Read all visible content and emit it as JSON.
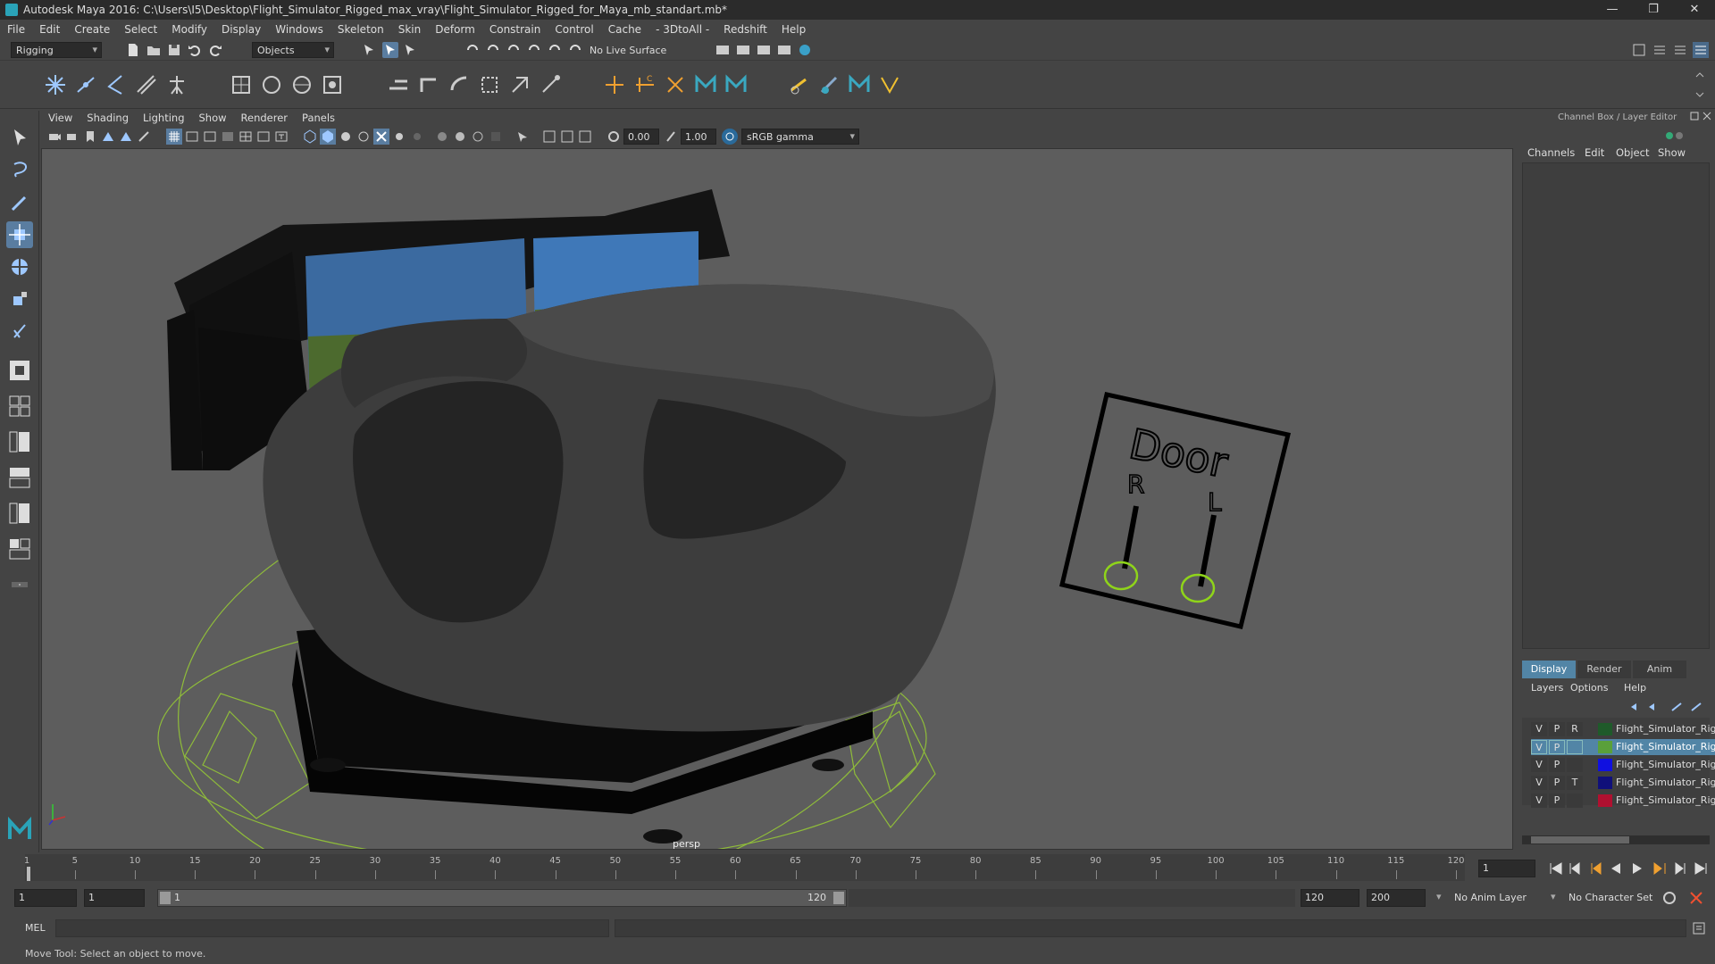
{
  "window": {
    "title": "Autodesk Maya 2016: C:\\Users\\I5\\Desktop\\Flight_Simulator_Rigged_max_vray\\Flight_Simulator_Rigged_for_Maya_mb_standart.mb*",
    "minimize": "—",
    "restore": "❐",
    "close": "✕"
  },
  "menubar": [
    "File",
    "Edit",
    "Create",
    "Select",
    "Modify",
    "Display",
    "Windows",
    "Skeleton",
    "Skin",
    "Deform",
    "Constrain",
    "Control",
    "Cache",
    "- 3DtoAll -",
    "Redshift",
    "Help"
  ],
  "statusline": {
    "menuset": "Rigging",
    "selection_mode": "Objects",
    "live_surface": "No Live Surface"
  },
  "panel": {
    "menus": [
      "View",
      "Shading",
      "Lighting",
      "Show",
      "Renderer",
      "Panels"
    ],
    "exposure": "0.00",
    "gamma": "1.00",
    "colorspace": "sRGB gamma",
    "camera_label": "persp"
  },
  "scene": {
    "door_label": "Door",
    "door_r": "R",
    "door_l": "L"
  },
  "channelbox": {
    "title": "Channel Box / Layer Editor",
    "menus": [
      "Channels",
      "Edit",
      "Object",
      "Show"
    ],
    "tabs": [
      "Display",
      "Render",
      "Anim"
    ],
    "layer_menus": [
      "Layers",
      "Options",
      "Help"
    ],
    "layers": [
      {
        "v": "V",
        "p": "P",
        "t": "R",
        "color": "#1f5a2a",
        "name": "Flight_Simulator_Rigg",
        "selected": false
      },
      {
        "v": "V",
        "p": "P",
        "t": "",
        "color": "#5aa03a",
        "name": "Flight_Simulator_Rigg",
        "selected": true
      },
      {
        "v": "V",
        "p": "P",
        "t": "",
        "color": "#1010e0",
        "name": "Flight_Simulator_Rigg",
        "selected": false
      },
      {
        "v": "V",
        "p": "P",
        "t": "T",
        "color": "#10107a",
        "name": "Flight_Simulator_Rigg",
        "selected": false
      },
      {
        "v": "V",
        "p": "P",
        "t": "",
        "color": "#b01030",
        "name": "Flight_Simulator_Rigg",
        "selected": false
      }
    ]
  },
  "timeline": {
    "ticks": [
      "1",
      "5",
      "10",
      "15",
      "20",
      "25",
      "30",
      "35",
      "40",
      "45",
      "50",
      "55",
      "60",
      "65",
      "70",
      "75",
      "80",
      "85",
      "90",
      "95",
      "100",
      "105",
      "110",
      "115",
      "120"
    ],
    "current_frame": "1"
  },
  "range": {
    "start": "1",
    "playback_start": "1",
    "slider_start": "1",
    "slider_end": "120",
    "playback_end": "120",
    "end": "200",
    "anim_layer": "No Anim Layer",
    "character_set": "No Character Set"
  },
  "cmdline": {
    "label": "MEL"
  },
  "helpline": {
    "text": "Move Tool: Select an object to move."
  }
}
